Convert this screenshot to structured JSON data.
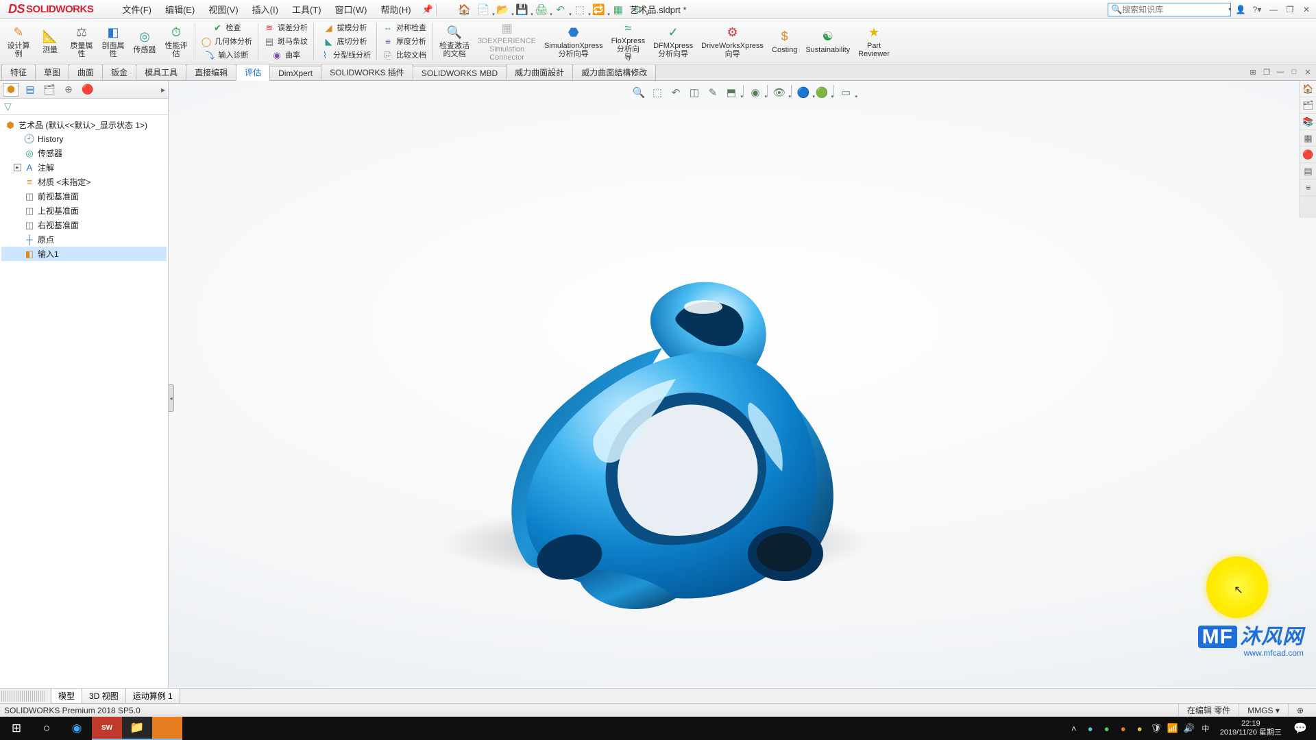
{
  "app": {
    "logo_text": "SOLIDWORKS",
    "doc_title": "艺术品.sldprt *"
  },
  "menus": [
    {
      "label": "文件(F)"
    },
    {
      "label": "编辑(E)"
    },
    {
      "label": "视图(V)"
    },
    {
      "label": "插入(I)"
    },
    {
      "label": "工具(T)"
    },
    {
      "label": "窗口(W)"
    },
    {
      "label": "帮助(H)"
    }
  ],
  "search": {
    "placeholder": "搜索知识库"
  },
  "ribbon": {
    "big": [
      {
        "label": "设计算\n例",
        "name": "design-study",
        "icon": "✎",
        "cls": "c-orange"
      },
      {
        "label": "测量",
        "name": "measure",
        "icon": "📐",
        "cls": "c-blue"
      },
      {
        "label": "质量属\n性",
        "name": "mass-props",
        "icon": "⚖",
        "cls": "c-gray"
      },
      {
        "label": "剖面属\n性",
        "name": "section-props",
        "icon": "◧",
        "cls": "c-blue"
      },
      {
        "label": "传感器",
        "name": "sensor",
        "icon": "◎",
        "cls": "c-teal"
      },
      {
        "label": "性能评\n估",
        "name": "perf-eval",
        "icon": "⏱",
        "cls": "c-green"
      }
    ],
    "col1": [
      {
        "label": "检查",
        "name": "check",
        "icon": "✔",
        "cls": "c-green"
      },
      {
        "label": "几何体分析",
        "name": "geom-analysis",
        "icon": "◯",
        "cls": "c-orange"
      },
      {
        "label": "输入诊断",
        "name": "import-diag",
        "icon": "⤵",
        "cls": "c-blue"
      }
    ],
    "col2": [
      {
        "label": "误差分析",
        "name": "deviation",
        "icon": "≋",
        "cls": "c-red"
      },
      {
        "label": "斑马条纹",
        "name": "zebra",
        "icon": "▤",
        "cls": "c-gray"
      },
      {
        "label": "曲率",
        "name": "curvature",
        "icon": "◉",
        "cls": "c-purple"
      }
    ],
    "col3": [
      {
        "label": "拔模分析",
        "name": "draft",
        "icon": "◢",
        "cls": "c-orange"
      },
      {
        "label": "底切分析",
        "name": "undercut",
        "icon": "◣",
        "cls": "c-teal"
      },
      {
        "label": "分型线分析",
        "name": "parting",
        "icon": "⌇",
        "cls": "c-blue"
      }
    ],
    "col4": [
      {
        "label": "对称检查",
        "name": "symmetry",
        "icon": "⇔",
        "cls": "c-green"
      },
      {
        "label": "厚度分析",
        "name": "thickness",
        "icon": "≡",
        "cls": "c-purple"
      },
      {
        "label": "比较文档",
        "name": "compare",
        "icon": "⎘",
        "cls": "c-gray"
      }
    ],
    "big2": [
      {
        "label": "检查激活\n的文档",
        "name": "check-active",
        "icon": "🔍",
        "cls": "c-green"
      },
      {
        "label": "3DEXPERIENCE\nSimulation\nConnector",
        "name": "3dx-sim",
        "icon": "▦",
        "cls": "c-gray",
        "disabled": true
      },
      {
        "label": "SimulationXpress\n分析向导",
        "name": "simxpress",
        "icon": "⬣",
        "cls": "c-blue"
      },
      {
        "label": "FloXpress\n分析向\n导",
        "name": "floxpress",
        "icon": "≈",
        "cls": "c-teal"
      },
      {
        "label": "DFMXpress\n分析向导",
        "name": "dfmxpress",
        "icon": "✓",
        "cls": "c-green"
      },
      {
        "label": "DriveWorksXpress\n向导",
        "name": "driveworks",
        "icon": "⚙",
        "cls": "c-red"
      },
      {
        "label": "Costing",
        "name": "costing",
        "icon": "$",
        "cls": "c-orange"
      },
      {
        "label": "Sustainability",
        "name": "sustain",
        "icon": "☯",
        "cls": "c-green"
      },
      {
        "label": "Part\nReviewer",
        "name": "part-reviewer",
        "icon": "★",
        "cls": "c-yellow"
      }
    ]
  },
  "tabs": [
    {
      "label": "特征"
    },
    {
      "label": "草图"
    },
    {
      "label": "曲面"
    },
    {
      "label": "钣金"
    },
    {
      "label": "模具工具"
    },
    {
      "label": "直接编辑"
    },
    {
      "label": "评估",
      "active": true
    },
    {
      "label": "DimXpert"
    },
    {
      "label": "SOLIDWORKS 插件"
    },
    {
      "label": "SOLIDWORKS MBD"
    },
    {
      "label": "威力曲面設計"
    },
    {
      "label": "威力曲面結構修改"
    }
  ],
  "tree": {
    "root": "艺术品  (默认<<默认>_显示状态 1>)",
    "nodes": [
      {
        "icon": "🕘",
        "label": "History",
        "cls": "c-gray"
      },
      {
        "icon": "◎",
        "label": "传感器",
        "cls": "c-teal"
      },
      {
        "icon": "A",
        "label": "注解",
        "cls": "c-blue",
        "expandable": true
      },
      {
        "icon": "≡",
        "label": "材质 <未指定>",
        "cls": "c-orange"
      },
      {
        "icon": "◫",
        "label": "前视基准面",
        "cls": "c-gray"
      },
      {
        "icon": "◫",
        "label": "上视基准面",
        "cls": "c-gray"
      },
      {
        "icon": "◫",
        "label": "右视基准面",
        "cls": "c-gray"
      },
      {
        "icon": "┼",
        "label": "原点",
        "cls": "c-blue"
      },
      {
        "icon": "◧",
        "label": "输入1",
        "cls": "c-orange",
        "selected": true
      }
    ]
  },
  "bottom_tabs": [
    {
      "label": "模型",
      "active": true
    },
    {
      "label": "3D 视图"
    },
    {
      "label": "运动算例 1"
    }
  ],
  "status": {
    "left": "SOLIDWORKS Premium 2018 SP5.0",
    "edit": "在编辑 零件",
    "units": "MMGS"
  },
  "watermark": {
    "brand_prefix": "MF",
    "brand": "沐风网",
    "url": "www.mfcad.com"
  },
  "taskbar": {
    "time": "22:19",
    "date": "2019/11/20 星期三"
  }
}
